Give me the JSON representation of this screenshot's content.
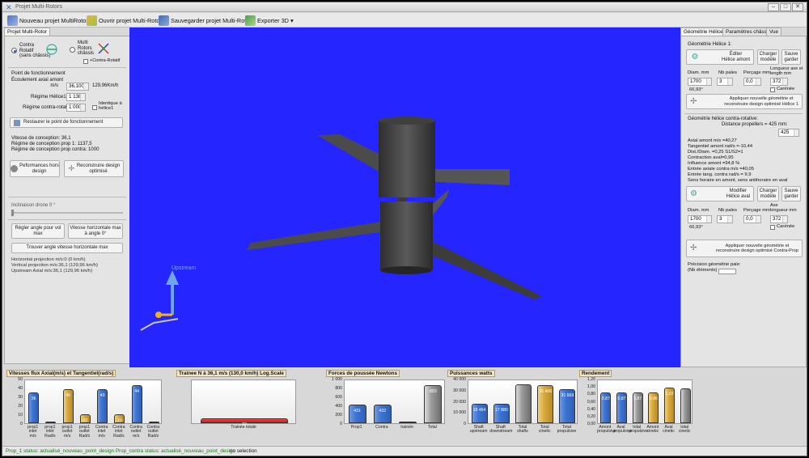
{
  "window": {
    "title": "Projet Multi-Rotors"
  },
  "toolbar": {
    "new": "Nouveau projet MultiRotor",
    "open": "Ouvrir projet Multi-Rotors",
    "save": "Sauvegarder projet Multi-Rotors",
    "export": "Exporter 3D"
  },
  "left": {
    "tab": "Projet Multi-Rotor",
    "radio_contra": "Contra\nRotatif\n(sans châssis)",
    "radio_multi": "Multi\nRotors\nchâssis",
    "contra_rotatif_label": "+Contra-Rotatif",
    "point_title": "Point de fonctionnement",
    "ecoulement_label": "Écoulement axial amont\nm/s",
    "ecoulement_value": "36,100",
    "ecoulement_kmh": "129,96Km/h",
    "regime_helice_label": "Régime Hélice1",
    "regime_helice_value": "1 138",
    "regime_contra_label": "Régime contra-rotatif",
    "regime_contra_value": "1 000",
    "identique_label": "Identique à\nhélice1",
    "restaurer_btn": "Restaurer le point de fonctionnement",
    "design_info": [
      "Vitesse de conception: 36,1",
      "Régime de conception prop 1: 1137,5",
      "Régime de conception prop contra: 1000"
    ],
    "perf_btn": "Peformances hors\ndesign",
    "reconstruire_btn": "Reconstruire design\noptimisé",
    "inclinaison_label": "Inclinaison drone 0 °",
    "regler_btn": "Régler angle pour vol\nmax",
    "vitesse_btn": "Vitesse horizontale max\nà angle 0°",
    "trouver_btn": "Trouver angle vitesse horizontale max",
    "projections": [
      "Horizontal projection m/s:0 (0 km/h)",
      "Vertical projection m/s:36,1 (129,96 km/h)",
      "Upstream Axial m/s:36,1 (129,96 km/h)"
    ]
  },
  "viewport": {
    "upstream_label": "Upstream"
  },
  "right": {
    "tabs": [
      "Géométrie Hélices",
      "Paramètres châssis",
      "Vue"
    ],
    "g1_title": "Géométrie Hélice 1:",
    "editer_btn": "Éditer\nHélice amont",
    "charger_btn": "Charger\nmodèle",
    "sauve_btn": "Sauve\ngarder",
    "col_diam": "Diam. mm",
    "col_pales": "Nb pales",
    "col_percage": "Perçage mm",
    "col_longueur": "Longueur axe et\nlength mm",
    "h1_diam": "1700",
    "h1_pales": "3",
    "h1_percage": "0,0",
    "h1_longueur": "372",
    "h1_angle": "66,93°",
    "carenee": "Carénée",
    "apply1": "Appliquer nouvelle géométrie et\nreconstruire design optimisé Hélice 1",
    "contra_title": "Géométrie hélice contra-rotative:",
    "distance_label": "Distance propellers = 425 mm:",
    "distance_value": "425",
    "info_lines": [
      "Axial amont m/s =40,27",
      "Tangentiel amont rad/s =-10,44",
      "Dist./Diam. =0,25 S1/S2=1",
      "Contraction aval=0,95",
      "Influence amont =94,8 %",
      "Entrée axiale contra m/s =40,05",
      "Entrée tang. contra rad/s = 9,9",
      "Sens horaire en amont, sens antihoraire en aval"
    ],
    "modifier_btn": "Modifier\nHélice aval",
    "col_longueur2": "Axe\nlongueur mm",
    "h2_diam": "1700",
    "h2_pales": "3",
    "h2_percage": "0,0",
    "h2_longueur": "372",
    "h2_angle": "66,93°",
    "apply2": "Appliquer nouvelle géométrie et\nreconstruire design optimisé Contra-Prop",
    "precision_label": "Précision géométrie pale:\n(Nb éléments)"
  },
  "charts_meta": {
    "bar_label_color": "#ffffff"
  },
  "chart_data": [
    {
      "type": "bar",
      "title": "Vitesses flux Axial(m/s) et Tangentiel(rad/s)",
      "ylim": [
        0,
        50
      ],
      "yticks": [
        "50",
        "40",
        "30",
        "20",
        "10",
        "0"
      ],
      "categories": [
        "prop1\ninlet\nm/s",
        "prop1\ninlet\nRad/s",
        "prop1\noutlet\nm/s",
        "prop1\noutlet\nRad/s",
        "Contra\ninlet\nm/s",
        "Contra\ninlet\nRad/s",
        "Contra\noutlet\nm/s",
        "Contra\noutlet\nRad/s"
      ],
      "values": [
        36,
        0,
        40,
        10,
        40,
        10,
        44,
        0
      ],
      "labels": [
        "36",
        "",
        "40",
        "10",
        "40",
        "10",
        "44",
        ""
      ],
      "colors": [
        "blue",
        "blue",
        "gold",
        "gold",
        "blue",
        "gold",
        "blue",
        "blue"
      ]
    },
    {
      "type": "bar",
      "title": "Trainee N à 36,1 m/s (130,0 km/h) Log.Scale",
      "ylim": [
        0,
        1
      ],
      "yticks": [],
      "categories": [
        "Trainée totale"
      ],
      "values": [
        0.12
      ],
      "labels": [
        "22"
      ],
      "colors": [
        "red"
      ]
    },
    {
      "type": "bar",
      "title": "Forces de poussée Newtons",
      "ylim": [
        0,
        1000
      ],
      "yticks": [
        "1 000",
        "800",
        "600",
        "400",
        "200",
        "0"
      ],
      "categories": [
        "Prop1",
        "Contra",
        "trainée",
        "Total"
      ],
      "values": [
        431,
        432,
        0,
        883
      ],
      "labels": [
        "431",
        "432",
        "",
        "883"
      ],
      "colors": [
        "blue",
        "blue",
        "blue",
        "gray"
      ]
    },
    {
      "type": "bar",
      "title": "Puissances watts",
      "ylim": [
        0,
        40000
      ],
      "yticks": [
        "40 000",
        "30 000",
        "20 000",
        "10 000",
        "0"
      ],
      "categories": [
        "Shaft\nupstream",
        "Shaft\ndownstream",
        "Total\nshafts",
        "Total\ncinetic",
        "Total\npropulsive"
      ],
      "values": [
        18464,
        17880,
        36344,
        35406,
        31669
      ],
      "labels": [
        "18 464",
        "17 880",
        "",
        "35 406",
        "31 669"
      ],
      "colors": [
        "blue",
        "blue",
        "gray",
        "gold",
        "blue"
      ]
    },
    {
      "type": "bar",
      "title": "Rendement",
      "ylim": [
        0,
        1.2
      ],
      "yticks": [
        "1,20",
        "1,00",
        "0,80",
        "0,60",
        "0,40",
        "0,20",
        "0,00"
      ],
      "categories": [
        "Amont\npropulsive",
        "Aval\npropulsive",
        "total\npropulsive",
        "Amont\ncinetic",
        "Aval\ncinetic",
        "total\ncinetic"
      ],
      "values": [
        0.87,
        0.87,
        0.87,
        0.86,
        1.0,
        0.97
      ],
      "labels": [
        "0,87",
        "0,87",
        "0,87",
        "0,86",
        "1,02",
        ""
      ],
      "colors": [
        "blue",
        "blue",
        "gray",
        "gold",
        "gold",
        "gray"
      ]
    }
  ],
  "status": {
    "text": "Prop_1 status: actualisé_nouveau_point_design Prop_contra status: actualisé_nouveau_point_design",
    "selection": "no selection"
  }
}
